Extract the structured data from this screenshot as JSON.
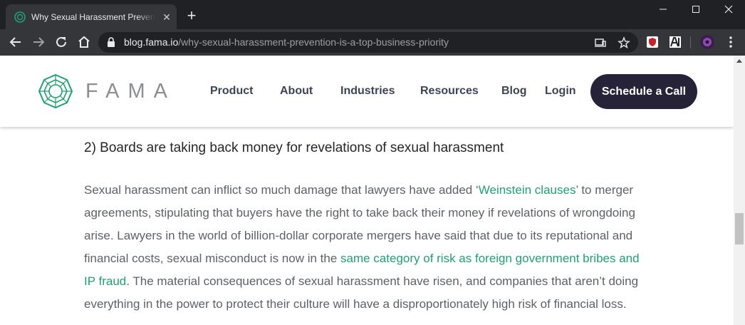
{
  "browser": {
    "tab_title": "Why Sexual Harassment Prevention is a Top Business Priority",
    "url_host": "blog.fama.io",
    "url_path": "/why-sexual-harassment-prevention-is-a-top-business-priority",
    "new_tab_label": "+",
    "tab_close_label": "✕"
  },
  "header": {
    "logo_text": "FAMA",
    "nav": [
      "Product",
      "About",
      "Industries",
      "Resources",
      "Blog",
      "Login"
    ],
    "cta_label": "Schedule a Call",
    "brand_color": "#21a071",
    "cta_color": "#262238"
  },
  "article": {
    "heading": "2) Boards are taking back money for revelations of sexual harassment",
    "line1_a": "Sexual harassment can inflict so much damage that lawyers have added ‘",
    "line1_link": "Weinstein clauses",
    "line1_b": "’ to merger",
    "line2": "agreements, stipulating that buyers have the right to take back their money if revelations of wrongdoing",
    "line3": "arise. Lawyers in the world of billion-dollar corporate mergers have said that due to its reputational and",
    "line4_a": "financial costs, sexual misconduct is now in the ",
    "line4_link": "same category of risk as foreign government bribes and",
    "line5_link": "IP fraud",
    "line5_b": ". The material consequences of sexual harassment have risen, and companies that aren’t doing",
    "line6": "everything in the power to protect their culture will have a disproportionately high risk of financial loss."
  }
}
